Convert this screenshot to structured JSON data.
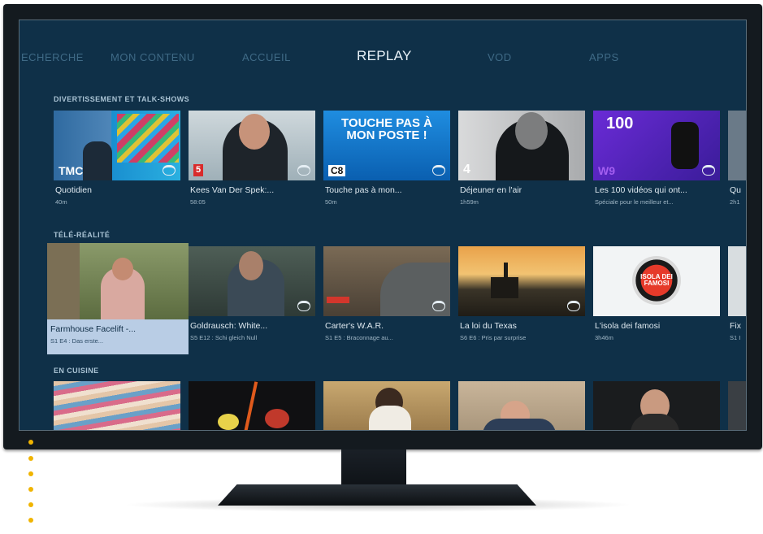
{
  "nav": {
    "items": [
      "ECHERCHE",
      "MON CONTENU",
      "ACCUEIL",
      "REPLAY",
      "VOD",
      "APPS"
    ],
    "active": "REPLAY"
  },
  "sections": [
    {
      "title": "DIVERTISSEMENT ET TALK-SHOWS",
      "cards": [
        {
          "title": "Quotidien",
          "subtitle": "40m",
          "channel": "TMC"
        },
        {
          "title": "Kees Van Der Spek:...",
          "subtitle": "58:05",
          "channel": "5"
        },
        {
          "title": "Touche pas à mon...",
          "subtitle": "50m",
          "channel": "C8",
          "thumb_text": "TOUCHE PAS À MON POSTE !"
        },
        {
          "title": "Déjeuner en l'air",
          "subtitle": "1h59m",
          "channel": "4"
        },
        {
          "title": "Les 100 vidéos qui ont...",
          "subtitle": "Spéciale pour le meilleur et...",
          "channel": "W9",
          "thumb_text": "100"
        },
        {
          "title": "Qu",
          "subtitle": "2h1"
        }
      ]
    },
    {
      "title": "TÉLÉ-RÉALITÉ",
      "cards": [
        {
          "title": "Farmhouse Facelift -...",
          "subtitle": "S1 E4 : Das erste...",
          "focused": true
        },
        {
          "title": "Goldrausch: White...",
          "subtitle": "S5 E12 : Schi gleich Null"
        },
        {
          "title": "Carter's W.A.R.",
          "subtitle": "S1 E5 : Braconnage au..."
        },
        {
          "title": "La loi du Texas",
          "subtitle": "S6 E6 : Pris par surprise"
        },
        {
          "title": "L'isola dei famosi",
          "subtitle": "3h46m",
          "thumb_text": "ISOLA DEI FAMOSI"
        },
        {
          "title": "Fix",
          "subtitle": "S1 I"
        }
      ]
    },
    {
      "title": "EN CUISINE",
      "cards": [
        {},
        {},
        {},
        {},
        {},
        {}
      ]
    }
  ],
  "colors": {
    "screen_bg": "#0f3048",
    "nav_active": "#e8f1f7",
    "nav_inactive": "#3f6a86",
    "focus": "#b9cde5",
    "accent_dots": "#f0b400"
  }
}
